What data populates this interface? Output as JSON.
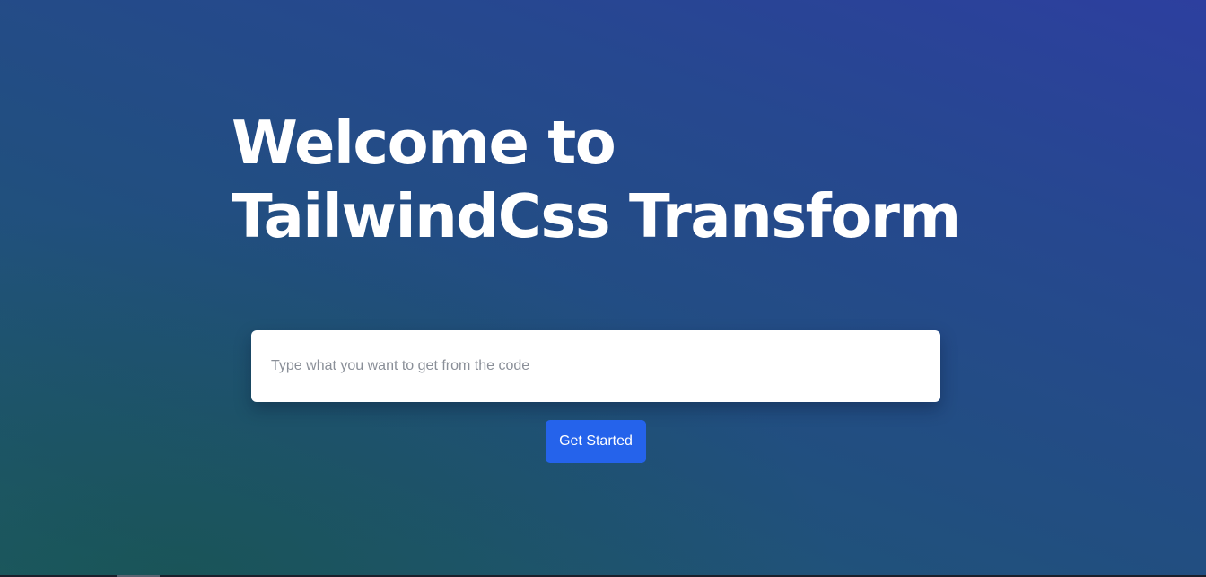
{
  "hero": {
    "title_line1": "Welcome to",
    "title_line2": "TailwindCss Transform"
  },
  "search": {
    "placeholder": "Type what you want to get from the code",
    "value": ""
  },
  "cta": {
    "label": "Get Started"
  },
  "colors": {
    "background_start": "#2d3f9f",
    "background_end": "#1e5a6c",
    "button": "#2563eb",
    "title": "#ffffff"
  }
}
